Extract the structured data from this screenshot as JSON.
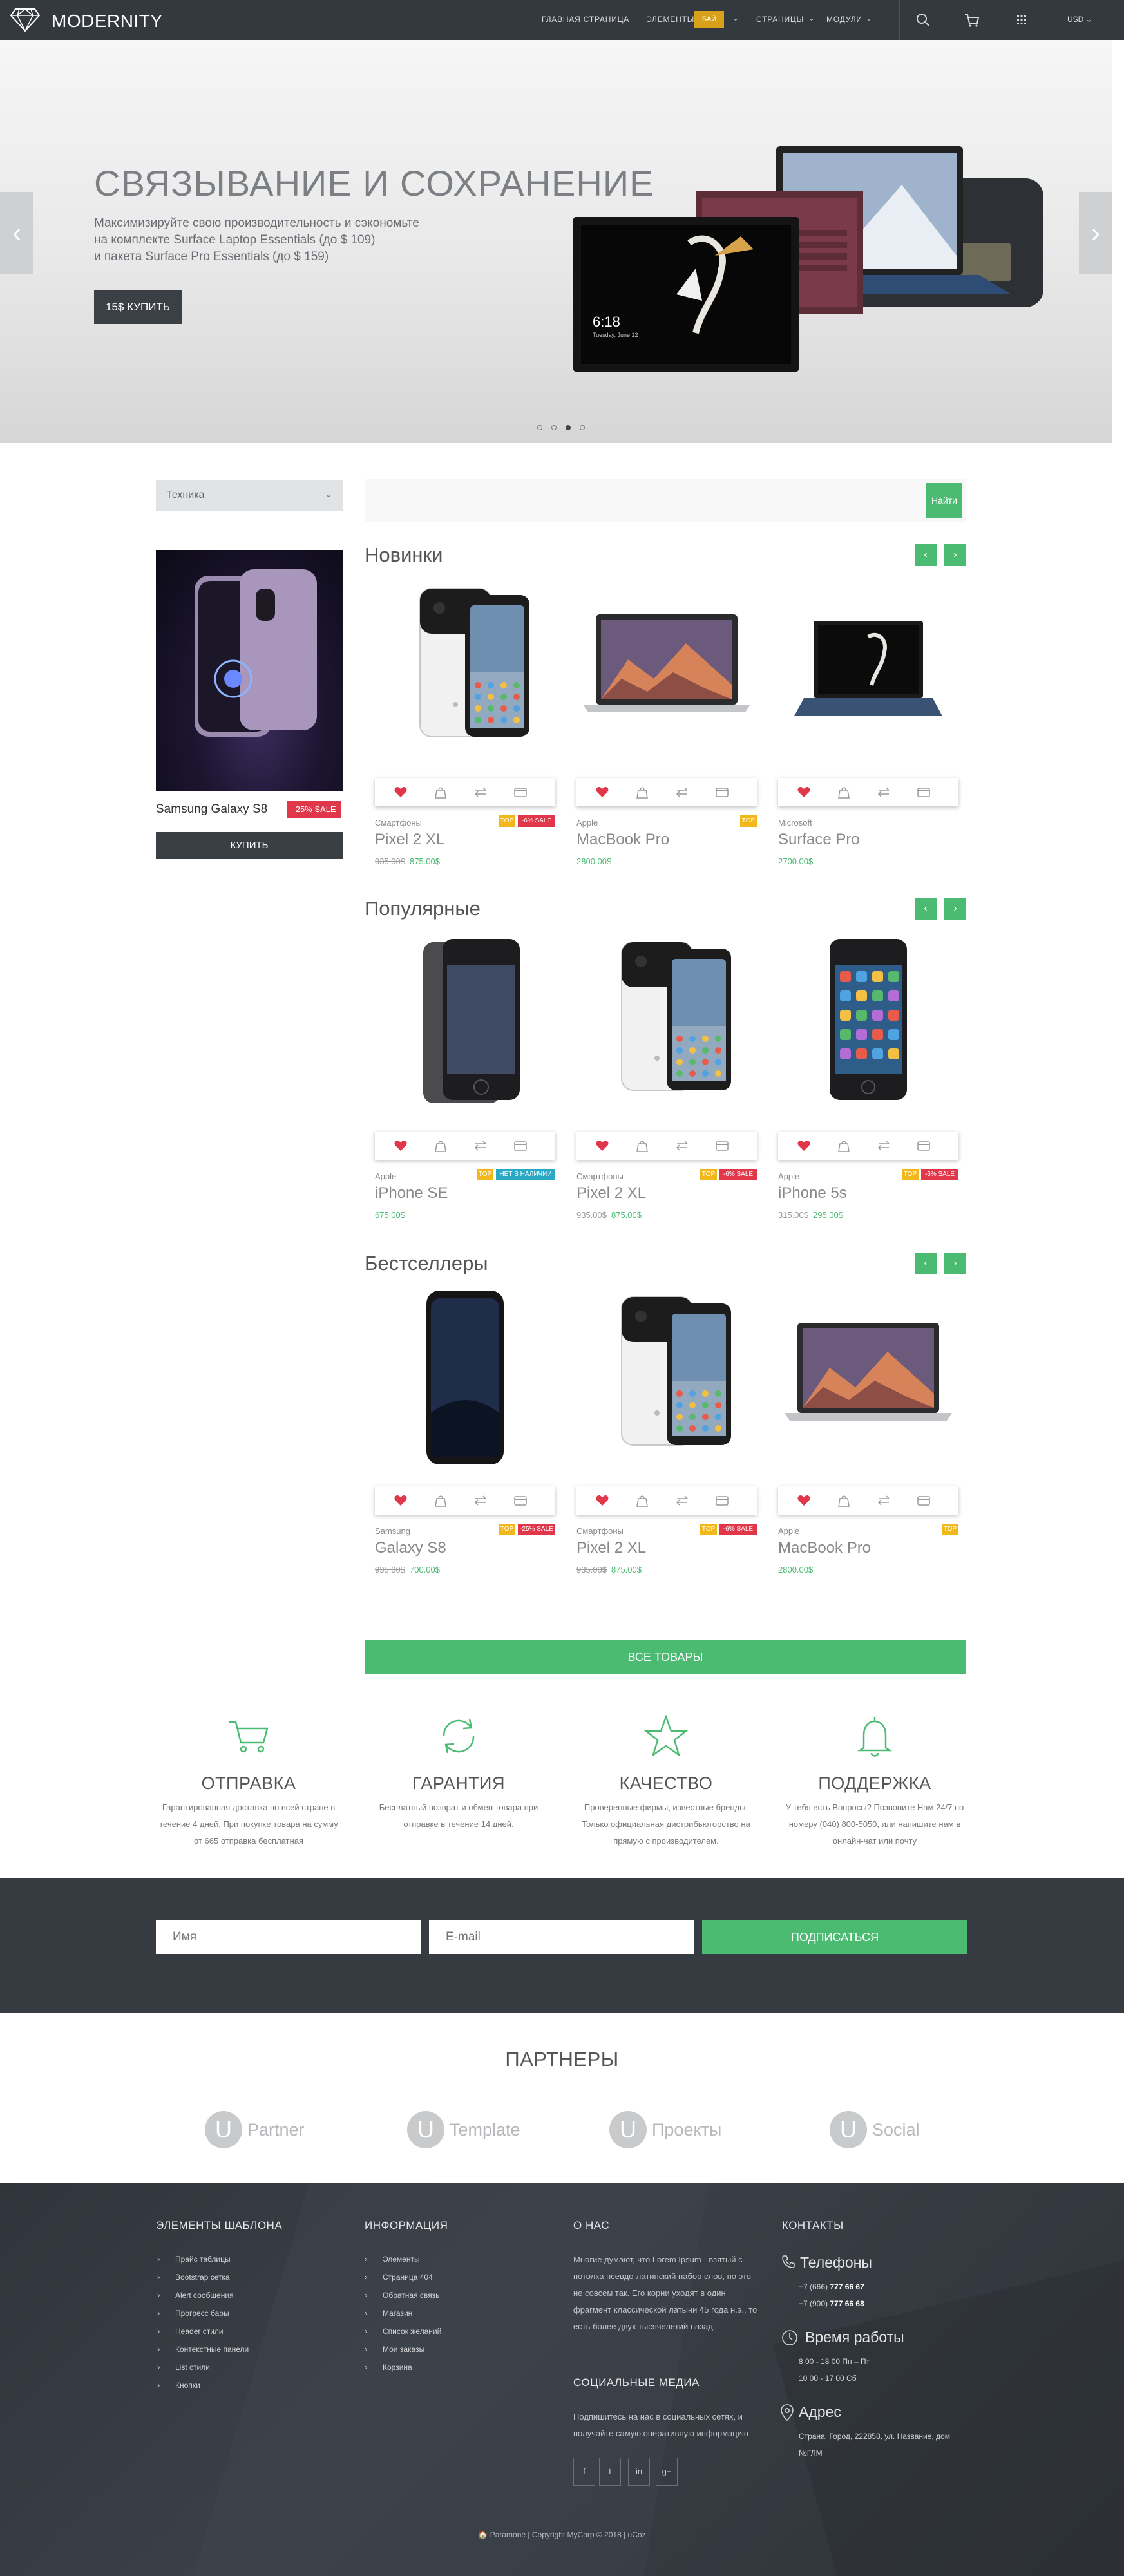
{
  "header": {
    "logo": "MODERNITY",
    "nav": [
      {
        "label": "ГЛАВНАЯ СТРАНИЦА"
      },
      {
        "label": "ЭЛЕМЕНТЫ",
        "badge": "БАЙ"
      },
      {
        "label": "СТРАНИЦЫ"
      },
      {
        "label": "МОДУЛИ"
      }
    ],
    "currency": "USD"
  },
  "hero": {
    "title": "СВЯЗЫВАНИЕ И СОХРАНЕНИЕ",
    "lines": [
      "Максимизируйте свою производительность и сэкономьте",
      "на комплекте Surface Laptop Essentials (до $ 109)",
      "и пакета Surface Pro Essentials (до $ 159)"
    ],
    "button": "15$ КУПИТЬ",
    "screen_time": "6:18",
    "screen_date": "Tuesday, June 12",
    "slides": 4,
    "active_slide": 3
  },
  "search": {
    "category": "Техника",
    "placeholder": "",
    "button": "Найти"
  },
  "promo": {
    "title": "Samsung Galaxy S8",
    "badge": "-25% SALE",
    "button": "КУПИТЬ"
  },
  "sections": [
    {
      "title": "Новинки",
      "products": [
        {
          "brand": "Смартфоны",
          "name": "Pixel 2 XL",
          "old_price": "935.00$",
          "price": "875.00$",
          "tags": [
            "TOP",
            "-6% SALE"
          ],
          "image": "pixel"
        },
        {
          "brand": "Apple",
          "name": "MacBook Pro",
          "old_price": "",
          "price": "2800.00$",
          "tags": [
            "TOP"
          ],
          "image": "macbook"
        },
        {
          "brand": "Microsoft",
          "name": "Surface Pro",
          "old_price": "",
          "price": "2700.00$",
          "tags": [],
          "image": "surface"
        }
      ]
    },
    {
      "title": "Популярные",
      "products": [
        {
          "brand": "Apple",
          "name": "iPhone SE",
          "old_price": "",
          "price": "675.00$",
          "tags": [
            "TOP",
            "НЕТ В НАЛИЧИИ"
          ],
          "image": "iphonese"
        },
        {
          "brand": "Смартфоны",
          "name": "Pixel 2 XL",
          "old_price": "935.00$",
          "price": "875.00$",
          "tags": [
            "TOP",
            "-6% SALE"
          ],
          "image": "pixel"
        },
        {
          "brand": "Apple",
          "name": "iPhone 5s",
          "old_price": "315.00$",
          "price": "295.00$",
          "tags": [
            "TOP",
            "-6% SALE"
          ],
          "image": "iphone5s"
        }
      ]
    },
    {
      "title": "Бестселлеры",
      "products": [
        {
          "brand": "Samsung",
          "name": "Galaxy S8",
          "old_price": "935.00$",
          "price": "700.00$",
          "tags": [
            "TOP",
            "-25% SALE"
          ],
          "image": "galaxy"
        },
        {
          "brand": "Смартфоны",
          "name": "Pixel 2 XL",
          "old_price": "935.00$",
          "price": "875.00$",
          "tags": [
            "TOP",
            "-6% SALE"
          ],
          "image": "pixel"
        },
        {
          "brand": "Apple",
          "name": "MacBook Pro",
          "old_price": "",
          "price": "2800.00$",
          "tags": [
            "TOP"
          ],
          "image": "macbook"
        }
      ]
    }
  ],
  "all_products_button": "ВСЕ ТОВАРЫ",
  "features": [
    {
      "icon": "cart-icon",
      "title": "ОТПРАВКА",
      "lines": [
        "Гарантированная доставка по всей стране в",
        "течение 4 дней. При покупке товара на сумму",
        "от 665 отправка бесплатная"
      ]
    },
    {
      "icon": "refresh-icon",
      "title": "ГАРАНТИЯ",
      "lines": [
        "Бесплатный возврат и обмен товара при",
        "отправке в течение 14 дней."
      ]
    },
    {
      "icon": "star-icon",
      "title": "КАЧЕСТВО",
      "lines": [
        "Проверенные фирмы, известные бренды.",
        "Только официальная дистрибьюторство на",
        "прямую с производителем."
      ]
    },
    {
      "icon": "bell-icon",
      "title": "ПОДДЕРЖКА",
      "lines": [
        "У тебя есть Вопросы? Позвоните Нам 24/7 по",
        "номеру (040) 800-5050, или напишите нам в",
        "онлайн-чат или почту"
      ]
    }
  ],
  "newsletter": {
    "name_placeholder": "Имя",
    "email_placeholder": "E-mail",
    "button": "ПОДПИСАТЬСЯ"
  },
  "partners": {
    "title": "ПАРТНЕРЫ",
    "items": [
      {
        "letter": "U",
        "name": "Partner"
      },
      {
        "letter": "U",
        "name": "Template"
      },
      {
        "letter": "U",
        "name": "Проекты"
      },
      {
        "letter": "U",
        "name": "Social"
      }
    ]
  },
  "footer": {
    "col1_title": "ЭЛЕМЕНТЫ ШАБЛОНА",
    "col1_links": [
      "Прайс таблицы",
      "Bootstrap сетка",
      "Alert сообщения",
      "Прогресс бары",
      "Header стили",
      "Контекстные панели",
      "List стили",
      "Кнопки"
    ],
    "col2_title": "ИНФОРМАЦИЯ",
    "col2_links": [
      "Элементы",
      "Страница 404",
      "Обратная связь",
      "Магазин",
      "Список желаний",
      "Мои заказы",
      "Корзина"
    ],
    "col3_title": "О НАС",
    "about_lines": [
      "Многие думают, что Lorem Ipsum - взятый с",
      "потолка псевдо-латинский набор слов, но это",
      "не совсем так. Его корни уходят в один",
      "фрагмент классической латыни 45 года н.э., то",
      "есть более двух тысячелетий назад."
    ],
    "social_title": "СОЦИАЛЬНЫЕ МЕДИА",
    "social_lines": [
      "Подпишитесь на нас в социальных сетях, и",
      "получайте самую оперативную информацию"
    ],
    "social_icons": [
      "f",
      "t",
      "in",
      "g+"
    ],
    "col4_title": "КОНТАКТЫ",
    "phones_title": "Телефоны",
    "phone1_prefix": "+7 (666) ",
    "phone1_num": "777 66 67",
    "phone2_prefix": "+7 (900) ",
    "phone2_num": "777 66 68",
    "hours_title": "Время работы",
    "hours1": "8 00 - 18 00 Пн – Пт",
    "hours2": "10 00 - 17 00 Сб",
    "address_title": "Адрес",
    "address_lines": [
      "Страна, Город, 222858, ул. Название, дом",
      "№ГЛМ"
    ],
    "copyright": "Paramone | Copyright MyCorp © 2018 | uCoz"
  }
}
